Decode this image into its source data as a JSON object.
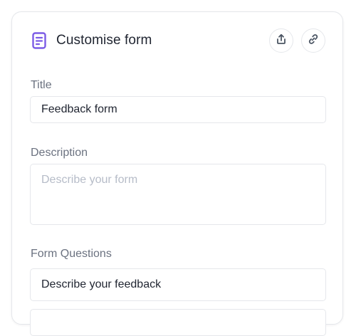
{
  "header": {
    "title": "Customise form",
    "icons": {
      "form": "document-icon",
      "share": "share-upload-icon",
      "link": "link-icon"
    },
    "accent_color": "#7c5ce6"
  },
  "fields": {
    "title": {
      "label": "Title",
      "value": "Feedback form"
    },
    "description": {
      "label": "Description",
      "value": "",
      "placeholder": "Describe your form"
    },
    "questions": {
      "label": "Form Questions",
      "items": [
        {
          "value": "Describe your feedback"
        },
        {
          "value": ""
        }
      ]
    }
  }
}
